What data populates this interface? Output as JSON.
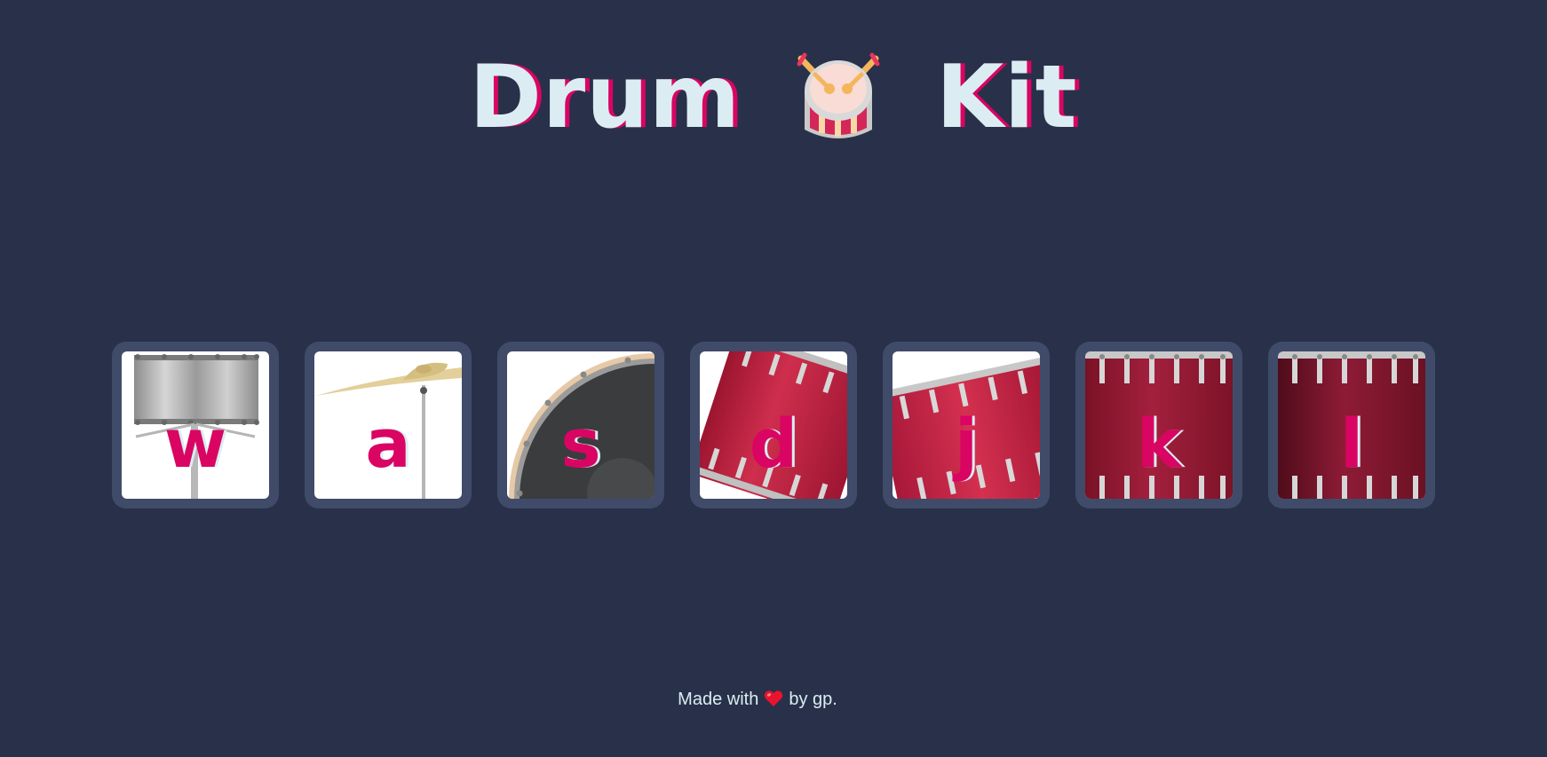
{
  "title": {
    "word_left": "Drum",
    "emoji_icon": "drum-with-drumsticks-icon",
    "word_right": "Kit"
  },
  "drums": [
    {
      "key": "w",
      "instrument_icon": "tom-drum-icon"
    },
    {
      "key": "a",
      "instrument_icon": "crash-cymbal-icon"
    },
    {
      "key": "s",
      "instrument_icon": "kick-drum-icon"
    },
    {
      "key": "d",
      "instrument_icon": "tom-drum-icon"
    },
    {
      "key": "j",
      "instrument_icon": "snare-drum-icon"
    },
    {
      "key": "k",
      "instrument_icon": "floor-tom-icon"
    },
    {
      "key": "l",
      "instrument_icon": "floor-tom-icon"
    }
  ],
  "footer": {
    "prefix": "Made with",
    "heart_icon": "heart-icon",
    "suffix": "by gp."
  },
  "colors": {
    "background": "#283149",
    "key_frame": "#404b69",
    "accent": "#da0463",
    "light": "#dbedf3"
  }
}
